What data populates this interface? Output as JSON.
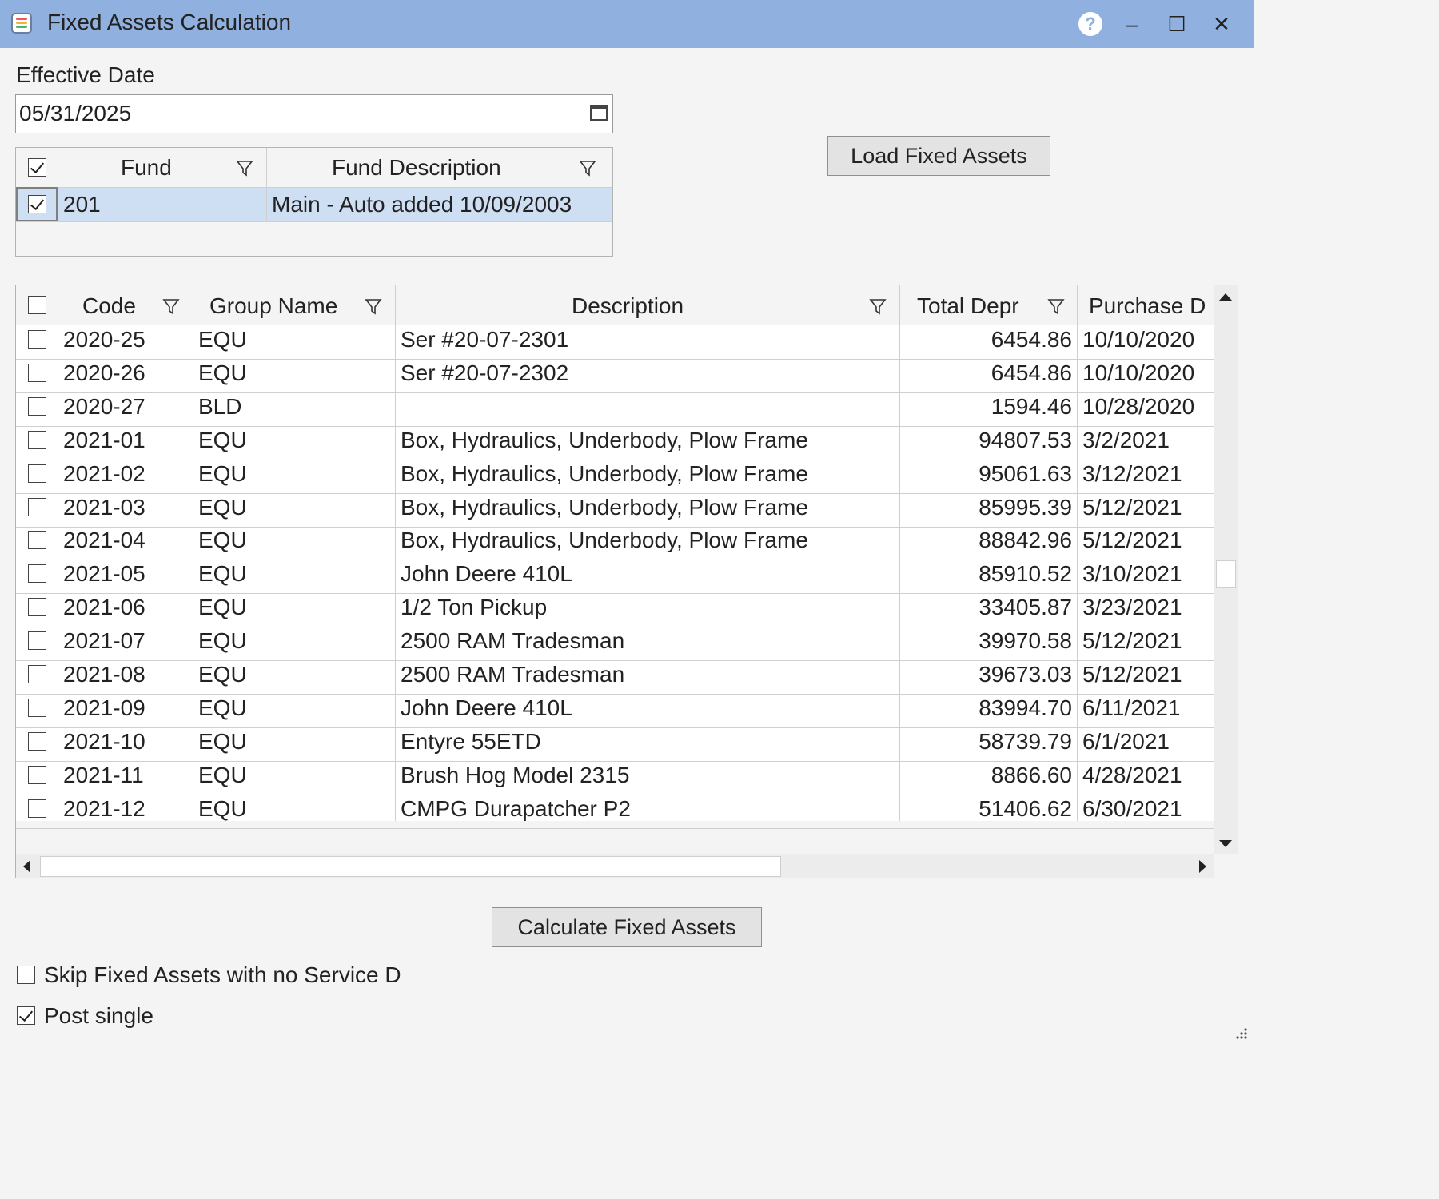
{
  "window": {
    "title": "Fixed Assets Calculation",
    "help_glyph": "?",
    "minimize_glyph": "–",
    "maximize_glyph": "☐",
    "close_glyph": "✕"
  },
  "effective_date": {
    "label": "Effective Date",
    "value": "05/31/2025"
  },
  "load_button": "Load Fixed Assets",
  "fund_grid": {
    "header_checked": true,
    "columns": [
      "Fund",
      "Fund Description"
    ],
    "rows": [
      {
        "checked": true,
        "fund": "201",
        "description": "Main - Auto added 10/09/2003"
      }
    ]
  },
  "asset_grid": {
    "header_checked": false,
    "columns": [
      "Code",
      "Group Name",
      "Description",
      "Total Depr",
      "Purchase D"
    ],
    "rows": [
      {
        "code": "2020-25",
        "group": "EQU",
        "description": "Ser #20-07-2301",
        "total_depr": "6454.86",
        "purchase": "10/10/2020"
      },
      {
        "code": "2020-26",
        "group": "EQU",
        "description": "Ser #20-07-2302",
        "total_depr": "6454.86",
        "purchase": "10/10/2020"
      },
      {
        "code": "2020-27",
        "group": "BLD",
        "description": "",
        "total_depr": "1594.46",
        "purchase": "10/28/2020"
      },
      {
        "code": "2021-01",
        "group": "EQU",
        "description": "Box, Hydraulics, Underbody, Plow Frame",
        "total_depr": "94807.53",
        "purchase": "3/2/2021"
      },
      {
        "code": "2021-02",
        "group": "EQU",
        "description": "Box, Hydraulics, Underbody, Plow Frame",
        "total_depr": "95061.63",
        "purchase": "3/12/2021"
      },
      {
        "code": "2021-03",
        "group": "EQU",
        "description": "Box, Hydraulics, Underbody, Plow Frame",
        "total_depr": "85995.39",
        "purchase": "5/12/2021"
      },
      {
        "code": "2021-04",
        "group": "EQU",
        "description": "Box, Hydraulics, Underbody, Plow Frame",
        "total_depr": "88842.96",
        "purchase": "5/12/2021"
      },
      {
        "code": "2021-05",
        "group": "EQU",
        "description": "John Deere 410L",
        "total_depr": "85910.52",
        "purchase": "3/10/2021"
      },
      {
        "code": "2021-06",
        "group": "EQU",
        "description": "1/2 Ton Pickup",
        "total_depr": "33405.87",
        "purchase": "3/23/2021"
      },
      {
        "code": "2021-07",
        "group": "EQU",
        "description": "2500 RAM Tradesman",
        "total_depr": "39970.58",
        "purchase": "5/12/2021"
      },
      {
        "code": "2021-08",
        "group": "EQU",
        "description": "2500 RAM Tradesman",
        "total_depr": "39673.03",
        "purchase": "5/12/2021"
      },
      {
        "code": "2021-09",
        "group": "EQU",
        "description": "John Deere 410L",
        "total_depr": "83994.70",
        "purchase": "6/11/2021"
      },
      {
        "code": "2021-10",
        "group": "EQU",
        "description": "Entyre 55ETD",
        "total_depr": "58739.79",
        "purchase": "6/1/2021"
      },
      {
        "code": "2021-11",
        "group": "EQU",
        "description": "Brush Hog Model 2315",
        "total_depr": "8866.60",
        "purchase": "4/28/2021"
      },
      {
        "code": "2021-12",
        "group": "EQU",
        "description": "CMPG Durapatcher P2",
        "total_depr": "51406.62",
        "purchase": "6/30/2021"
      }
    ]
  },
  "calculate_button": "Calculate Fixed Assets",
  "options": {
    "skip_label": "Skip Fixed Assets with no Service D",
    "skip_checked": false,
    "post_single_label": "Post single",
    "post_single_checked": true
  }
}
